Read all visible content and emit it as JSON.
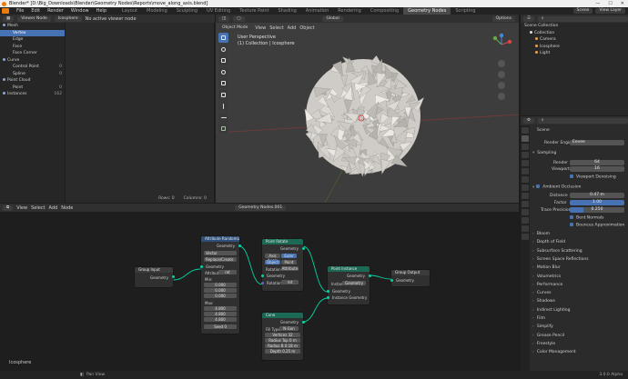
{
  "window": {
    "title": "Blender* [D:\\Big_Downloads\\Blender\\Geometry Nodes\\Reports\\move_along_axis.blend]",
    "controls": [
      "—",
      "☐",
      "✕"
    ]
  },
  "menu": [
    "File",
    "Edit",
    "Render",
    "Window",
    "Help"
  ],
  "workspaces": [
    "Layout",
    "Modeling",
    "Sculpting",
    "UV Editing",
    "Texture Paint",
    "Shading",
    "Animation",
    "Rendering",
    "Compositing",
    "Geometry Nodes",
    "Scripting"
  ],
  "active_workspace": "Geometry Nodes",
  "scene": {
    "label": "Scene",
    "view_layer": "View Layer"
  },
  "spreadsheet": {
    "editor": "Viewer Node",
    "object": "Icosphere",
    "viewer_status": "No active viewer node",
    "domains": [
      {
        "group": "Mesh",
        "items": [
          {
            "name": "Vertex",
            "count": "",
            "selected": true
          },
          {
            "name": "Edge",
            "count": ""
          },
          {
            "name": "Face",
            "count": ""
          },
          {
            "name": "Face Corner",
            "count": ""
          }
        ]
      },
      {
        "group": "Curve",
        "items": [
          {
            "name": "Control Point",
            "count": "0"
          },
          {
            "name": "Spline",
            "count": "0"
          }
        ]
      },
      {
        "group": "Point Cloud",
        "items": [
          {
            "name": "Point",
            "count": "0"
          }
        ]
      },
      {
        "group": "Instances",
        "count": "162",
        "items": []
      }
    ],
    "rows": "Rows: 0",
    "columns": "Columns: 0"
  },
  "viewport": {
    "mode": "Object Mode",
    "menus": [
      "View",
      "Select",
      "Add",
      "Object"
    ],
    "orientation": "Global",
    "perspective": "User Perspective",
    "collection": "(1) Collection | Icosphere",
    "options": "Options"
  },
  "outliner": {
    "title": "Scene Collection",
    "items": [
      {
        "name": "Collection",
        "level": 1
      },
      {
        "name": "Camera",
        "level": 2
      },
      {
        "name": "Icosphere",
        "level": 2
      },
      {
        "name": "Light",
        "level": 2
      }
    ]
  },
  "properties": {
    "scene": "Scene",
    "render_engine_label": "Render Engine",
    "render_engine": "Eevee",
    "sampling": "Sampling",
    "render_label": "Render",
    "render_value": "64",
    "viewport_label": "Viewport",
    "viewport_value": "16",
    "viewport_denoising": "Viewport Denoising",
    "ao": "Ambient Occlusion",
    "distance_label": "Distance",
    "distance": "0.47 m",
    "factor_label": "Factor",
    "factor": "1.00",
    "trace_label": "Trace Precision",
    "trace": "0.250",
    "bent_normals": "Bent Normals",
    "bounces": "Bounces Approximation",
    "panels": [
      "Bloom",
      "Depth of Field",
      "Subsurface Scattering",
      "Screen Space Reflections",
      "Motion Blur",
      "Volumetrics",
      "Performance",
      "Curves",
      "Shadows",
      "Indirect Lighting",
      "Film",
      "Simplify",
      "Grease Pencil",
      "Freestyle",
      "Color Management"
    ]
  },
  "node_editor": {
    "menus": [
      "View",
      "Select",
      "Add",
      "Node"
    ],
    "tree_name": "Geometry Nodes.001",
    "object": "Icosphere",
    "nodes": {
      "group_input": {
        "title": "Group Input",
        "out": "Geometry"
      },
      "attr_random": {
        "title": "Attribute Randomize",
        "out": "Geometry",
        "type": "Vector",
        "op": "Replace/Create",
        "in": "Geometry",
        "attr_label": "Attribute",
        "attr": "rot",
        "min_label": "Min:",
        "min": [
          "0.000",
          "0.000",
          "0.000"
        ],
        "max_label": "Max:",
        "max": [
          "4.800",
          "4.800",
          "4.800"
        ],
        "seed_label": "Seed",
        "seed": "0"
      },
      "point_rotate": {
        "title": "Point Rotate",
        "out": "Geometry",
        "mode1": "Axis Angle",
        "mode2": "Euler",
        "t1": "Object",
        "t2": "Point",
        "rot_label": "Rotation",
        "rot_type": "Attribute",
        "in": "Geometry",
        "rot2_label": "Rotation",
        "rot": "rot"
      },
      "point_instance": {
        "title": "Point Instance",
        "out": "Geometry",
        "inst_label": "Instan",
        "inst_type": "Geometry",
        "in": "Geometry",
        "in2": "Instance Geometry"
      },
      "group_output": {
        "title": "Group Output",
        "in": "Geometry"
      },
      "cone": {
        "title": "Cone",
        "out": "Geometry",
        "fill_label": "Fill Type",
        "fill": "N-Gon",
        "vertices_label": "Vertices",
        "vertices": "32",
        "r_top_label": "Radius Top",
        "r_top": "0 m",
        "r_bottom_label": "Radius B",
        "r_bottom": "0.18 m",
        "depth_label": "Depth",
        "depth": "0.25 m"
      }
    }
  },
  "status": {
    "left": "Pan View",
    "version": "3.0.0 Alpha"
  },
  "colors": {
    "accent": "#4772b3",
    "geometry_socket": "#00d6a3",
    "vector_socket": "#6363c7",
    "logo": "#e87d0d"
  }
}
